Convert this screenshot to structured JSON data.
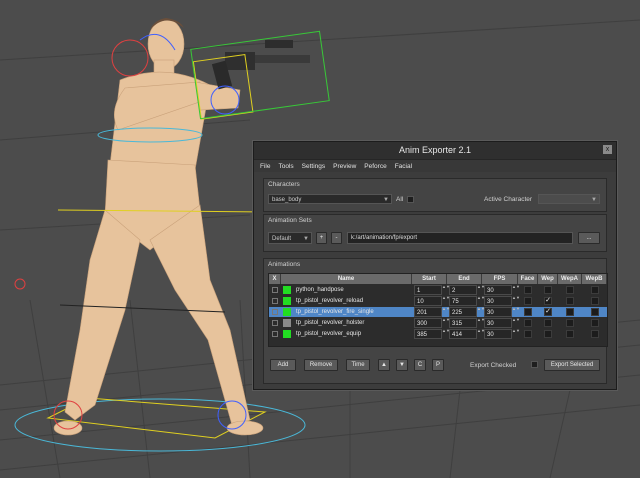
{
  "window": {
    "title": "Anim Exporter 2.1",
    "close_glyph": "x"
  },
  "menu": [
    "File",
    "Tools",
    "Settings",
    "Preview",
    "Peforce",
    "Facial"
  ],
  "characters": {
    "group_title": "Characters",
    "selected": "base_body",
    "all_label": "All",
    "active_label": "Active Character",
    "active_value": ""
  },
  "animation_sets": {
    "group_title": "Animation Sets",
    "selected": "Default",
    "add_label": "+",
    "remove_label": "-",
    "path": "k:/art/animation/fp/export",
    "browse_label": "..."
  },
  "animations": {
    "group_title": "Animations",
    "columns": [
      "X",
      "Name",
      "Start",
      "End",
      "FPS",
      "Face",
      "Wep",
      "WepA",
      "WepB"
    ],
    "rows": [
      {
        "name": "python_handpose",
        "start": "1",
        "end": "2",
        "fps": "30",
        "color": "#22dd22",
        "wep": false,
        "selected": false
      },
      {
        "name": "tp_pistol_revolver_reload",
        "start": "10",
        "end": "75",
        "fps": "30",
        "color": "#22dd22",
        "wep": true,
        "selected": false
      },
      {
        "name": "tp_pistol_revolver_fire_single",
        "start": "201",
        "end": "225",
        "fps": "30",
        "color": "#22dd22",
        "wep": true,
        "selected": true
      },
      {
        "name": "tp_pistol_revolver_holster",
        "start": "300",
        "end": "315",
        "fps": "30",
        "color": "#8a8a8a",
        "wep": false,
        "selected": false
      },
      {
        "name": "tp_pistol_revolver_equip",
        "start": "385",
        "end": "414",
        "fps": "30",
        "color": "#22dd22",
        "wep": false,
        "selected": false
      }
    ],
    "buttons": {
      "add": "Add",
      "remove": "Remove",
      "time": "Time",
      "up": "▲",
      "down": "▼",
      "c": "C",
      "p": "P",
      "export_checked": "Export Checked",
      "export_selected": "Export Selected"
    }
  },
  "colors": {
    "viewport_bg": "#4c4c4c",
    "grid": "#3a3a3a",
    "selection_highlight": "#4f86c6",
    "green_swatch": "#22dd22"
  }
}
